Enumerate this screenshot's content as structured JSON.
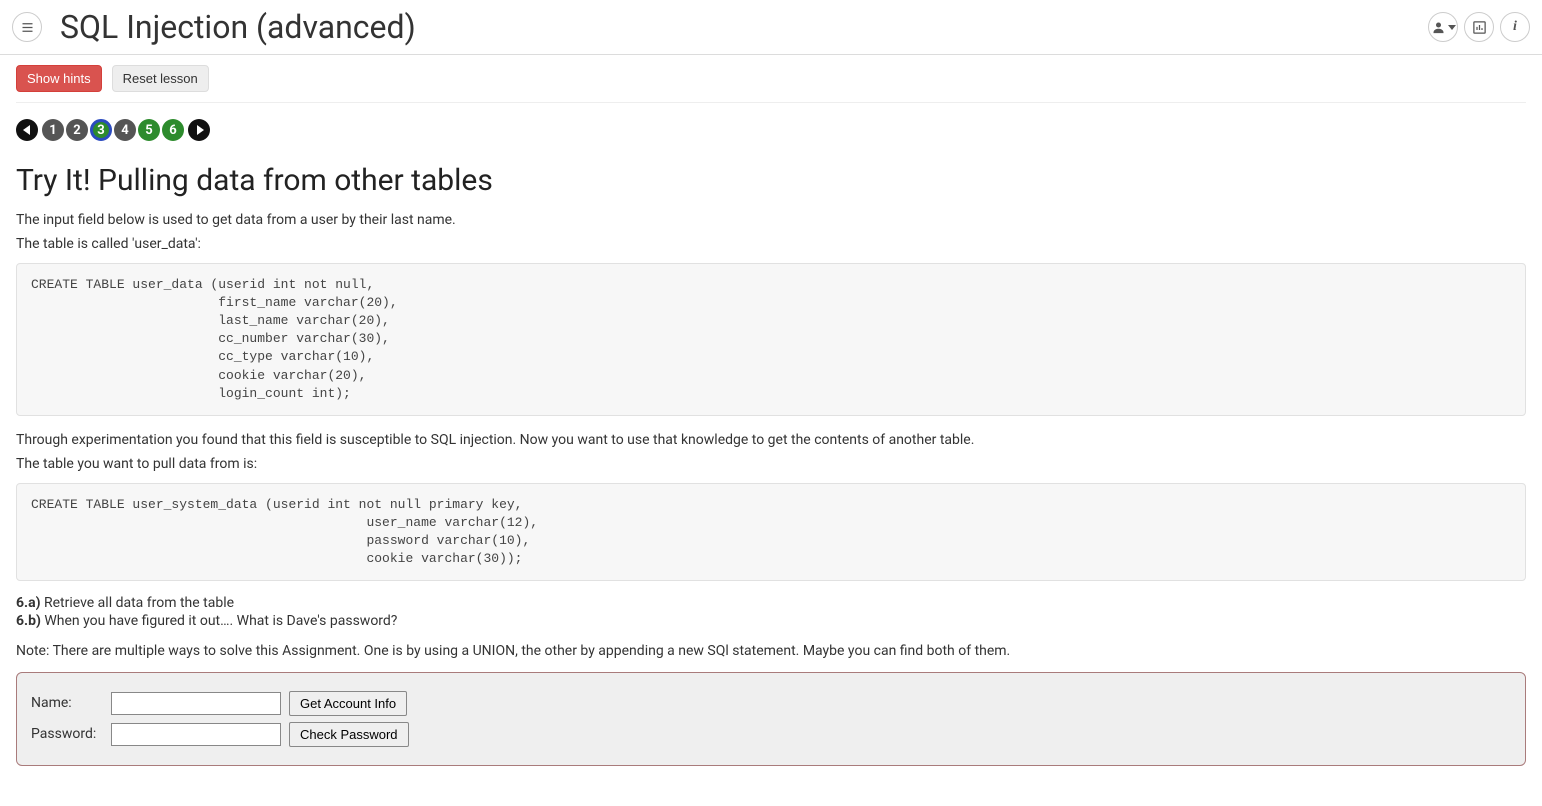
{
  "header": {
    "title": "SQL Injection (advanced)"
  },
  "toolbar": {
    "show_hints": "Show hints",
    "reset_lesson": "Reset lesson"
  },
  "pagination": {
    "pages": [
      {
        "num": "1",
        "color": "grey",
        "current": false
      },
      {
        "num": "2",
        "color": "grey",
        "current": false
      },
      {
        "num": "3",
        "color": "green",
        "current": true
      },
      {
        "num": "4",
        "color": "grey",
        "current": false
      },
      {
        "num": "5",
        "color": "green",
        "current": false
      },
      {
        "num": "6",
        "color": "green",
        "current": false
      }
    ]
  },
  "lesson": {
    "heading": "Try It! Pulling data from other tables",
    "intro1": "The input field below is used to get data from a user by their last name.",
    "intro2": "The table is called 'user_data':",
    "code1": "CREATE TABLE user_data (userid int not null,\n                        first_name varchar(20),\n                        last_name varchar(20),\n                        cc_number varchar(30),\n                        cc_type varchar(10),\n                        cookie varchar(20),\n                        login_count int);",
    "mid1": "Through experimentation you found that this field is susceptible to SQL injection. Now you want to use that knowledge to get the contents of another table.",
    "mid2": "The table you want to pull data from is:",
    "code2": "CREATE TABLE user_system_data (userid int not null primary key,\n                                           user_name varchar(12),\n                                           password varchar(10),\n                                           cookie varchar(30));",
    "task_a_label": "6.a)",
    "task_a_text": " Retrieve all data from the table",
    "task_b_label": "6.b)",
    "task_b_text": " When you have figured it out…. What is Dave's password?",
    "note": "Note: There are multiple ways to solve this Assignment. One is by using a UNION, the other by appending a new SQl statement. Maybe you can find both of them."
  },
  "form": {
    "name_label": "Name:",
    "name_value": "",
    "get_info_btn": "Get Account Info",
    "password_label": "Password:",
    "password_value": "",
    "check_pwd_btn": "Check Password"
  }
}
